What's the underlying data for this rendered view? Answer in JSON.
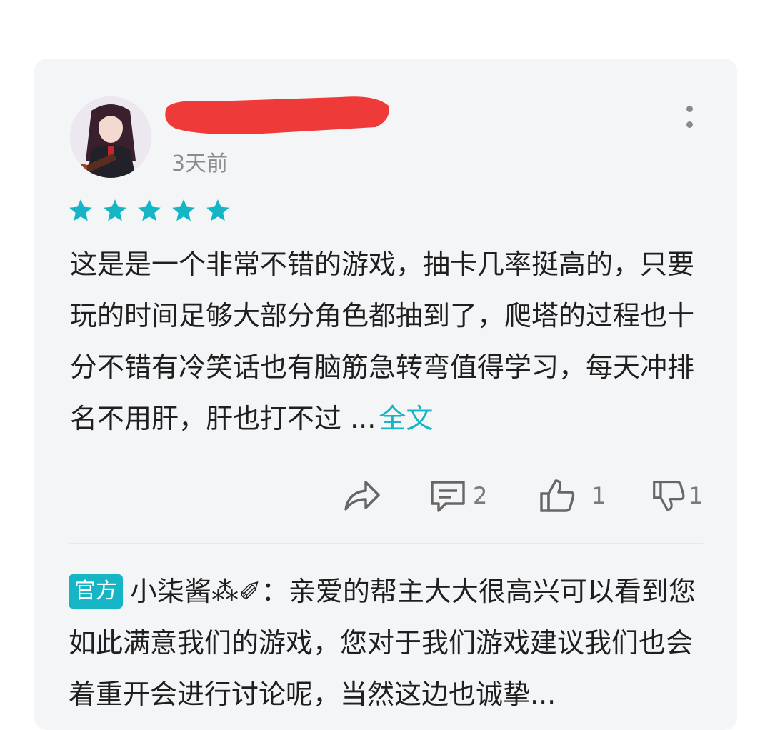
{
  "review": {
    "time": "3天前",
    "rating": 5,
    "rating_max": 5,
    "text": "这是是一个非常不错的游戏，抽卡几率挺高的，只要玩的时间足够大部分角色都抽到了，爬塔的过程也十分不错有冷笑话也有脑筋急转弯值得学习，每天冲排名不用肝，肝也打不过 ...",
    "more_link": "全文",
    "reply_count": "2",
    "like_count": "1",
    "dislike_count": "1"
  },
  "colors": {
    "accent": "#16b5c5",
    "redaction": "#ef3a3a",
    "card_bg": "#f4f5f7"
  },
  "icons": [
    "more-vertical-icon",
    "star-icon",
    "share-icon",
    "comment-icon",
    "thumbs-up-icon",
    "thumbs-down-icon"
  ],
  "official_reply": {
    "badge": "官方",
    "author": "小柒酱⁂✐",
    "separator": "：",
    "text": "亲爱的帮主大大很高兴可以看到您如此满意我们的游戏，您对于我们游戏建议我们也会着重开会进行讨论呢，当然这边也诚挚..."
  }
}
